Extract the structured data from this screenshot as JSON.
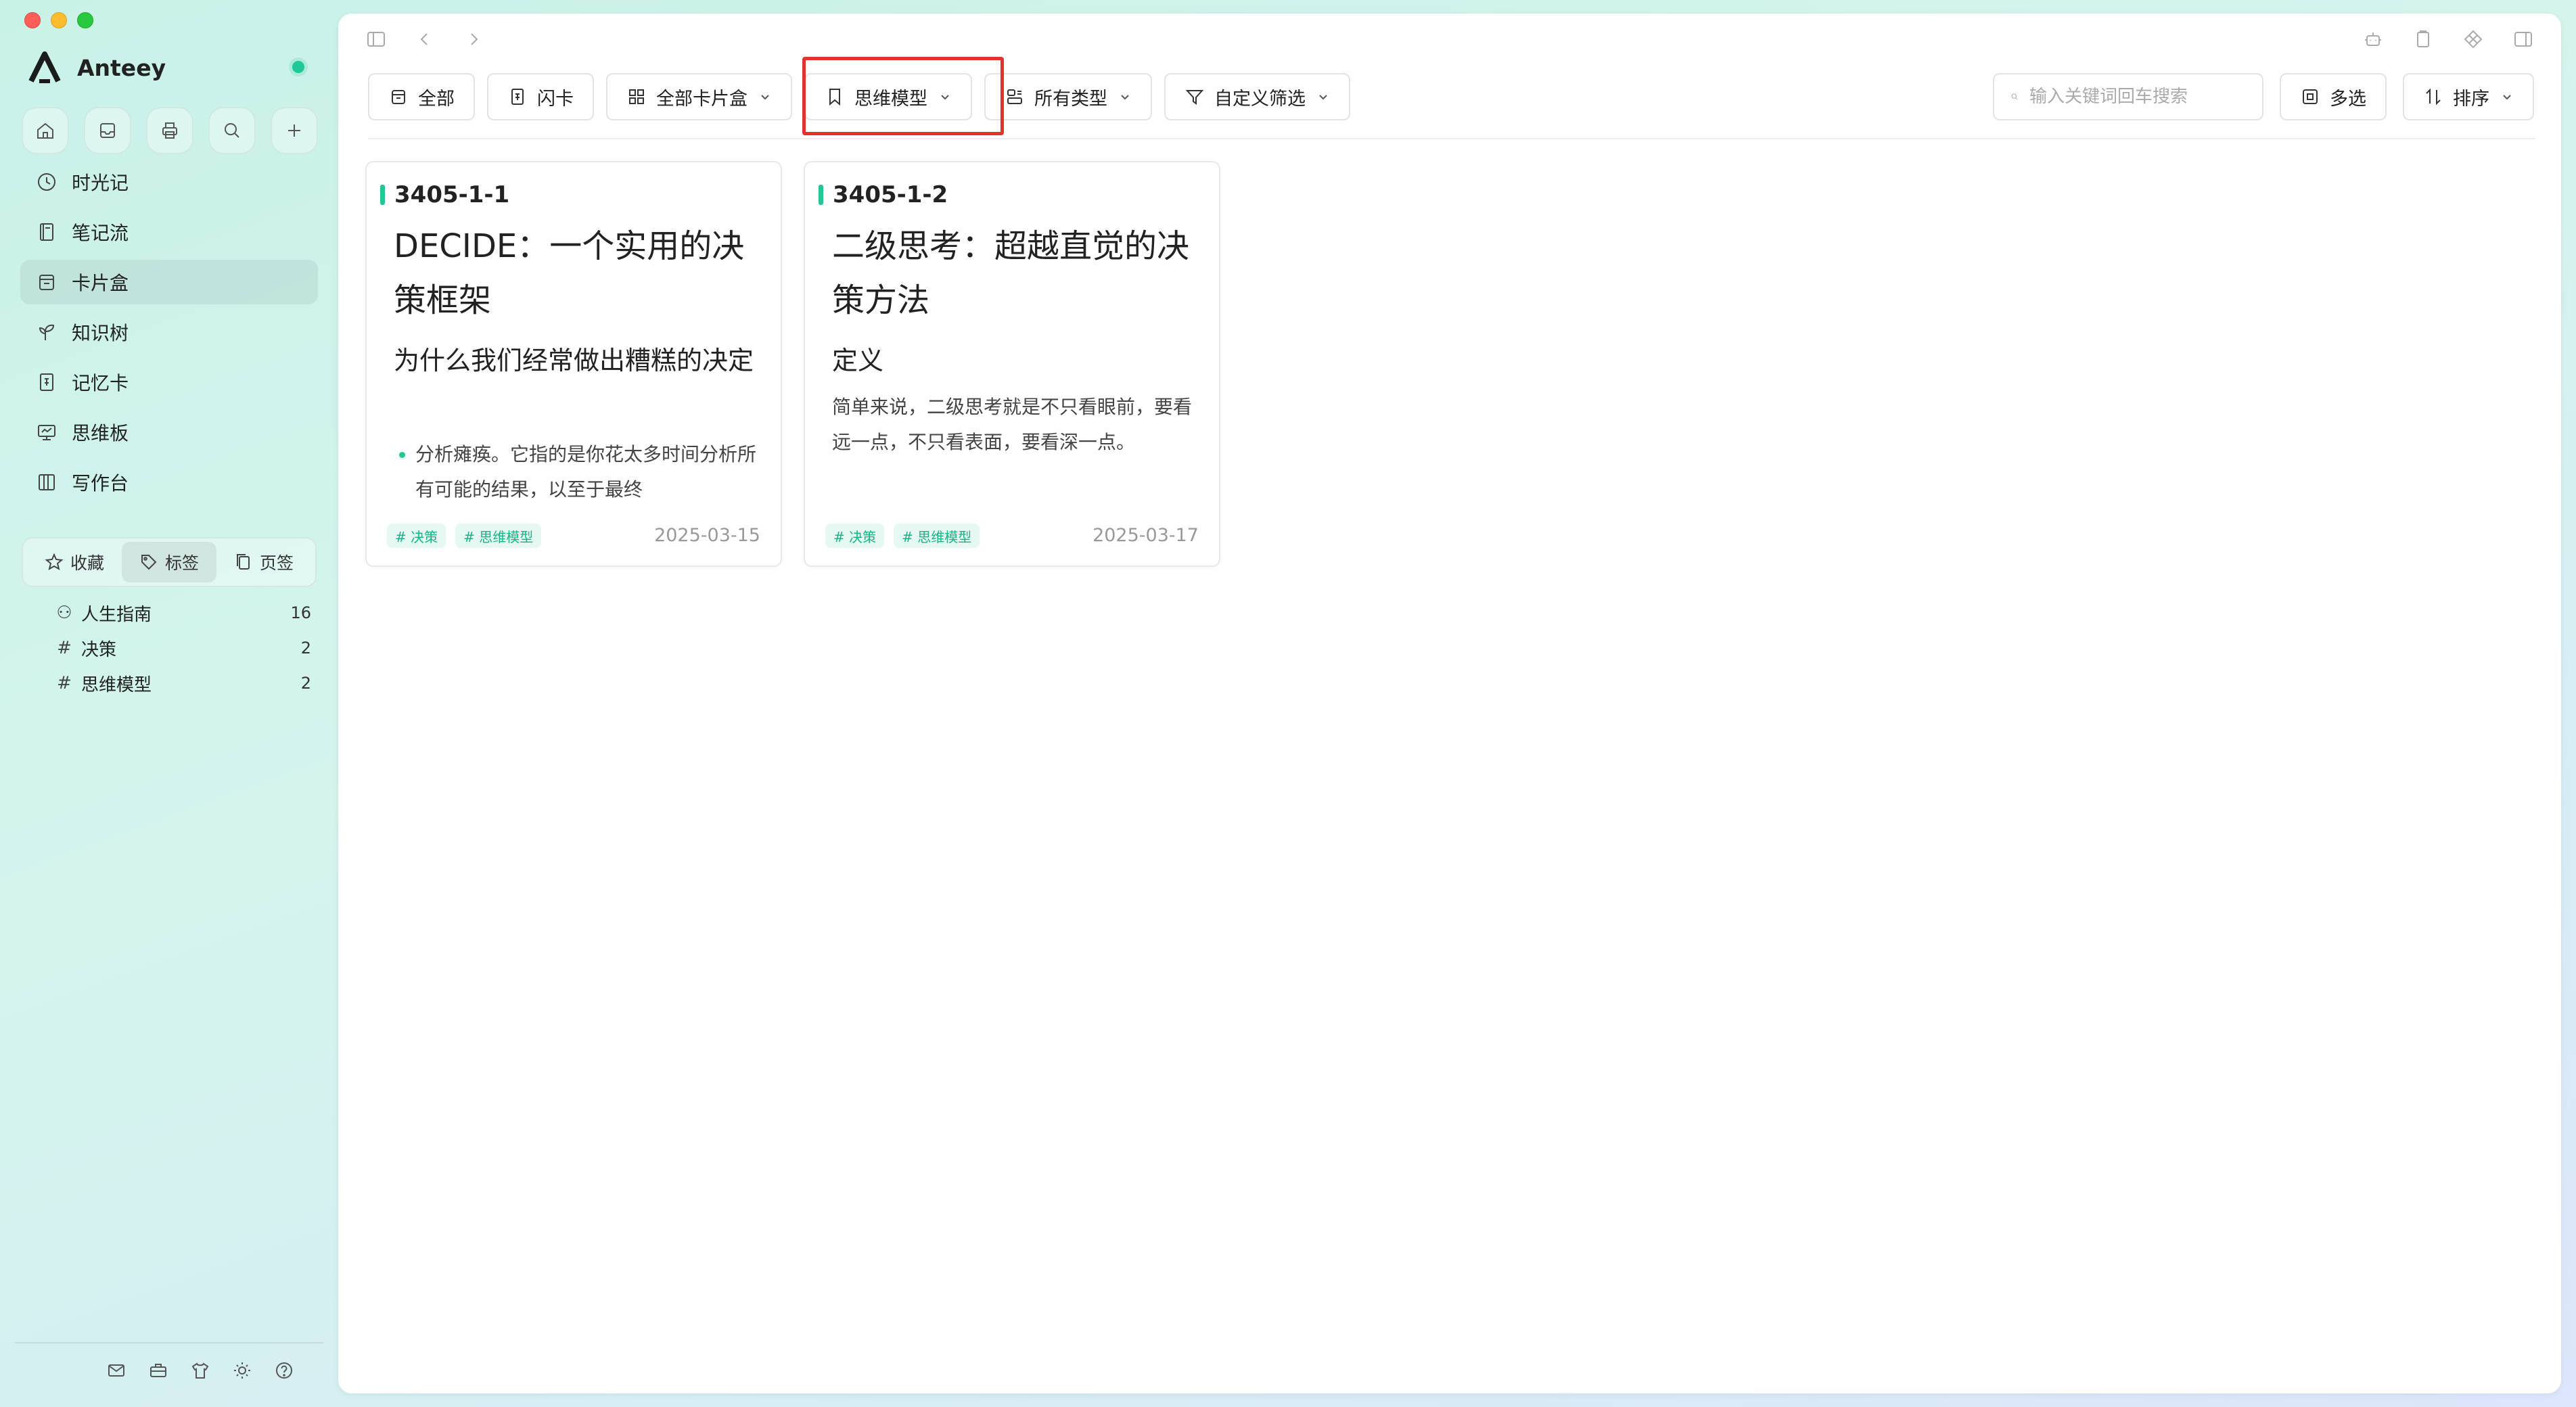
{
  "app": {
    "name": "Anteey"
  },
  "sidebar": {
    "quick_icons": [
      "home-icon",
      "inbox-icon",
      "printer-icon",
      "search-icon",
      "plus-icon"
    ],
    "items": [
      {
        "label": "时光记",
        "icon": "clock-icon"
      },
      {
        "label": "笔记流",
        "icon": "notebook-icon"
      },
      {
        "label": "卡片盒",
        "icon": "card-box-icon",
        "active": true
      },
      {
        "label": "知识树",
        "icon": "sprout-icon"
      },
      {
        "label": "记忆卡",
        "icon": "memory-card-icon"
      },
      {
        "label": "思维板",
        "icon": "whiteboard-icon"
      },
      {
        "label": "写作台",
        "icon": "writing-desk-icon"
      }
    ],
    "segments": [
      {
        "label": "收藏",
        "icon": "star-icon"
      },
      {
        "label": "标签",
        "icon": "tag-icon",
        "active": true
      },
      {
        "label": "页签",
        "icon": "pages-icon"
      }
    ],
    "tags": [
      {
        "name": "人生指南",
        "count": "16",
        "icon": "tag-group-icon"
      },
      {
        "name": "决策",
        "count": "2",
        "icon": "hash-icon"
      },
      {
        "name": "思维模型",
        "count": "2",
        "icon": "hash-icon"
      }
    ],
    "footer_icons": [
      "mail-icon",
      "toolbox-icon",
      "shirt-icon",
      "sun-icon",
      "help-icon"
    ]
  },
  "toolbar": {
    "all_label": "全部",
    "flash_label": "闪卡",
    "boxes_label": "全部卡片盒",
    "model_label": "思维模型",
    "types_label": "所有类型",
    "filter_label": "自定义筛选",
    "search_placeholder": "输入关键词回车搜索",
    "multi_label": "多选",
    "sort_label": "排序"
  },
  "cards": [
    {
      "id": "3405-1-1",
      "title": "DECIDE：一个实用的决策框架",
      "subtitle": "为什么我们经常做出糟糕的决定",
      "bullet": "分析瘫痪。它指的是你花太多时间分析所有可能的结果，以至于最终",
      "tags": [
        "# 决策",
        "# 思维模型"
      ],
      "date": "2025-03-15"
    },
    {
      "id": "3405-1-2",
      "title": "二级思考：超越直觉的决策方法",
      "subtitle": "定义",
      "body": "简单来说，二级思考就是不只看眼前，要看远一点，不只看表面，要看深一点。",
      "tags": [
        "# 决策",
        "# 思维模型"
      ],
      "date": "2025-03-17"
    }
  ],
  "colors": {
    "accent": "#1fc896",
    "highlight": "#e5322d"
  }
}
